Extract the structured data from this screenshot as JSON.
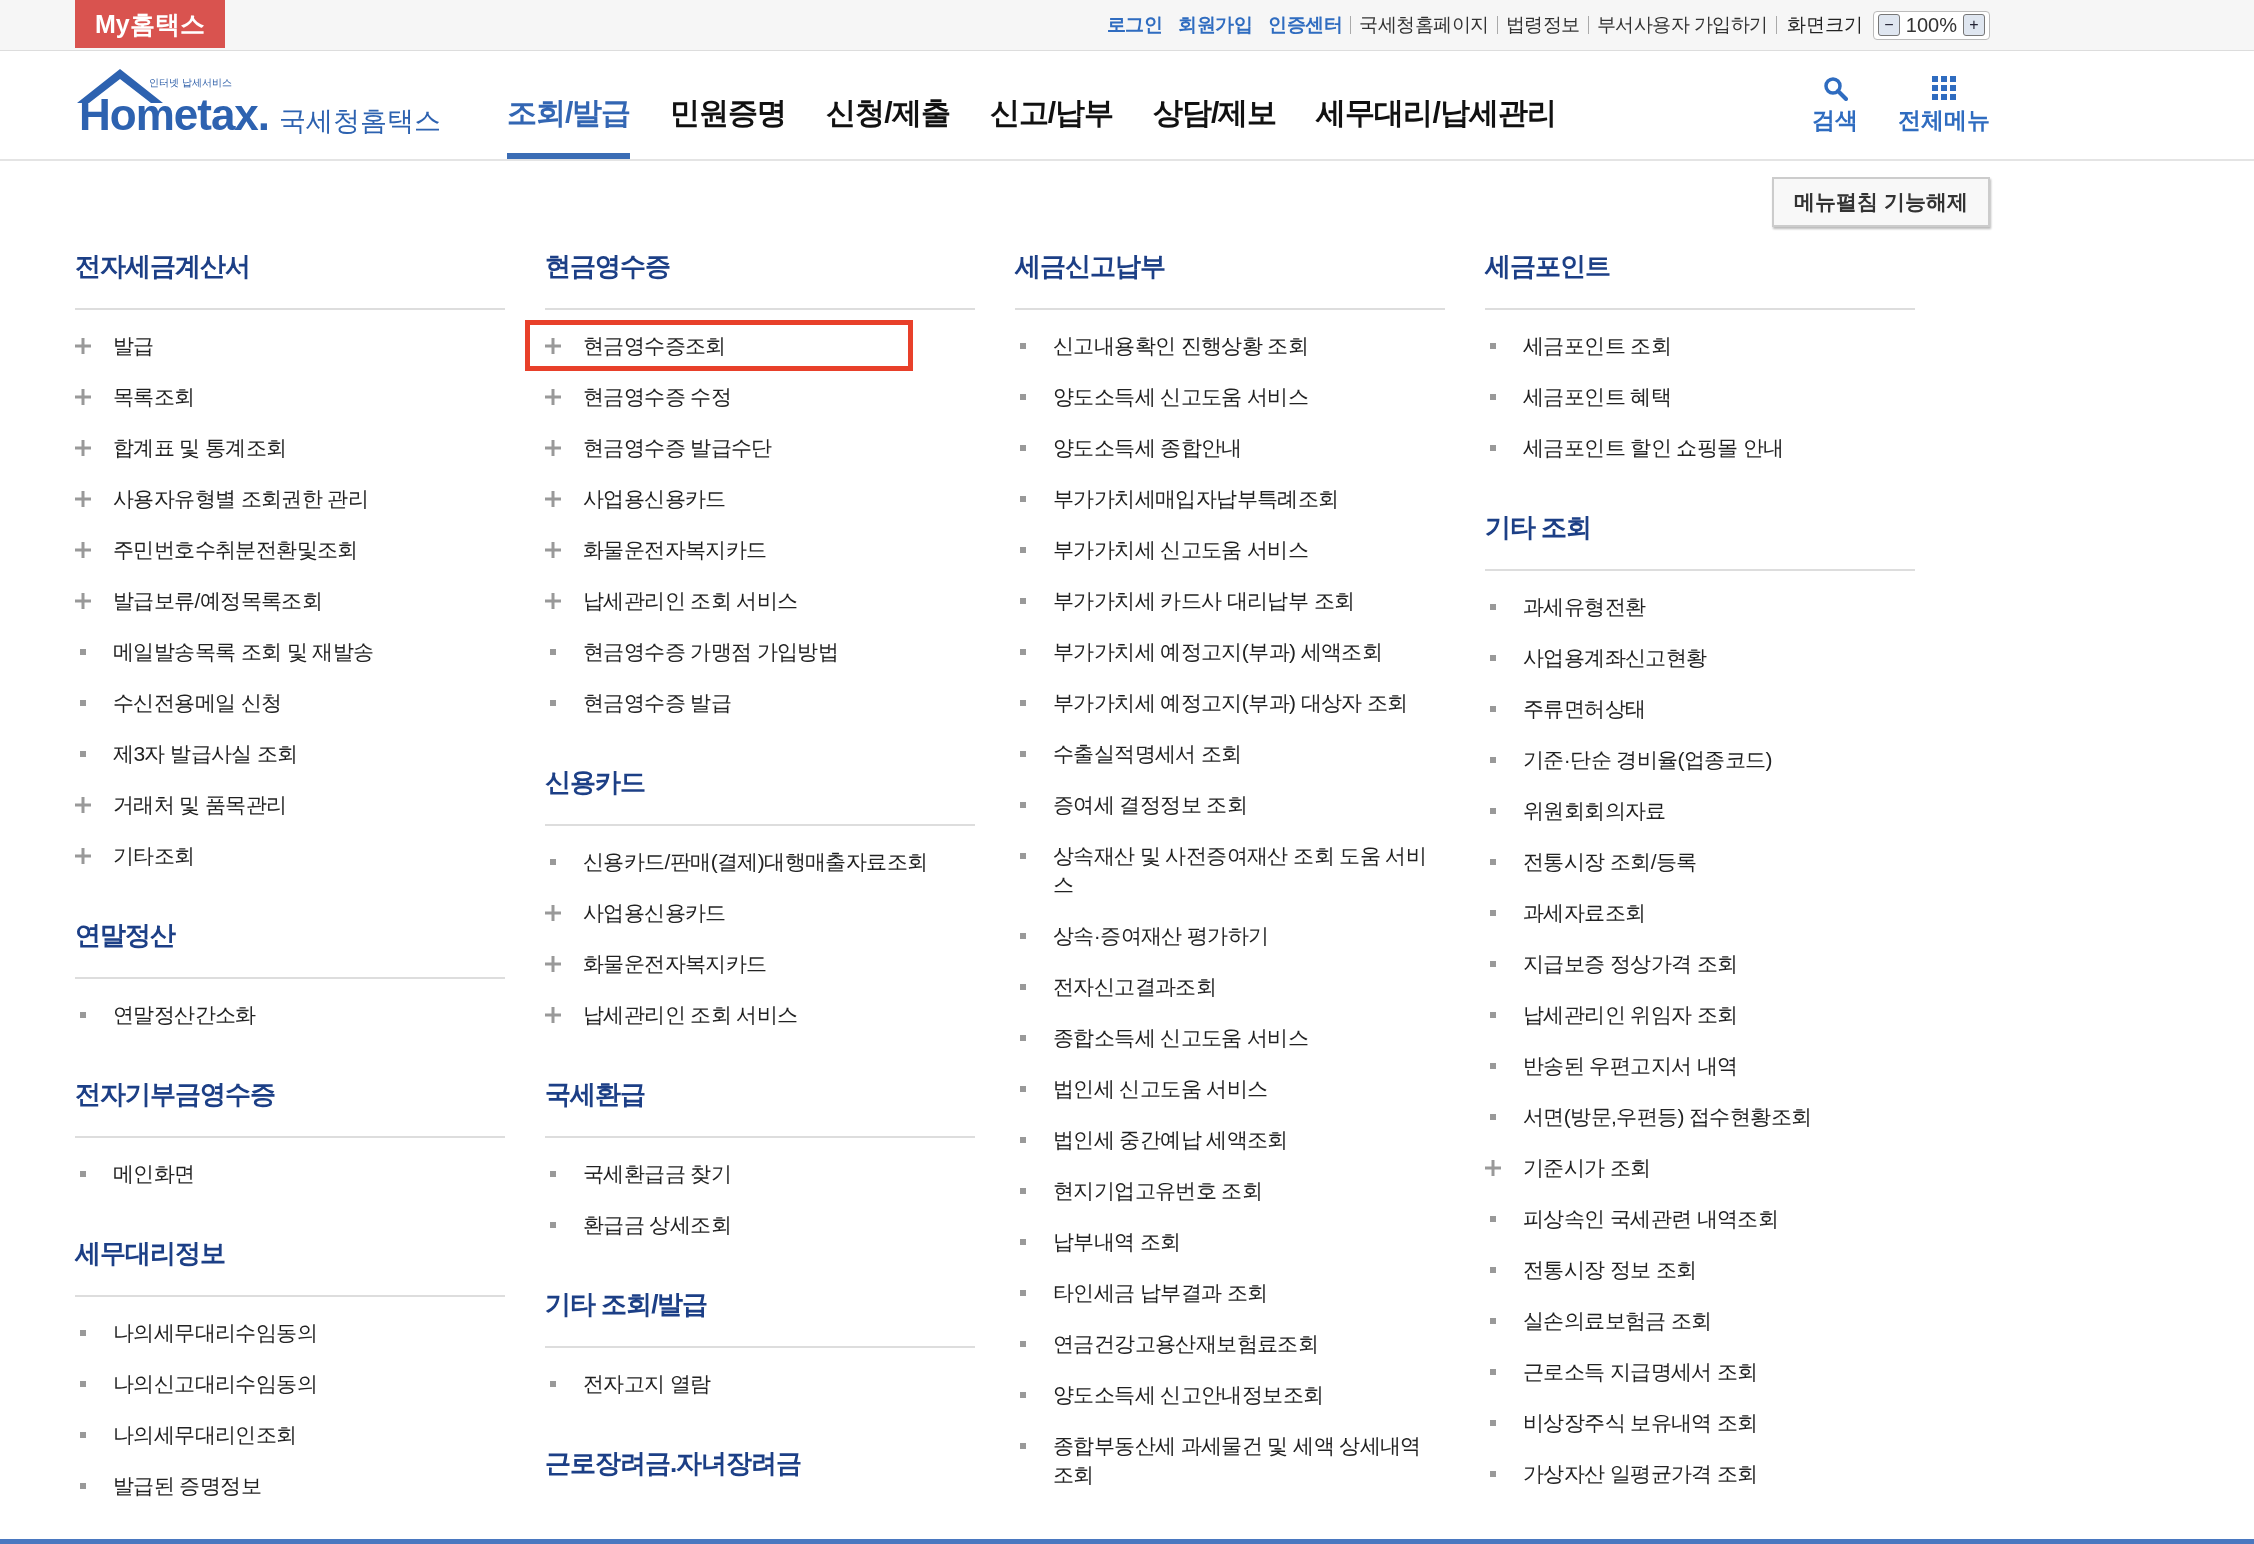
{
  "top_bar": {
    "my_tab": "My홈택스",
    "links": [
      {
        "label": "로그인",
        "emphasis": true
      },
      {
        "label": "회원가입",
        "emphasis": true
      },
      {
        "label": "인증센터",
        "emphasis": true
      },
      {
        "label": "국세청홈페이지",
        "emphasis": false
      },
      {
        "label": "법령정보",
        "emphasis": false
      },
      {
        "label": "부서사용자 가입하기",
        "emphasis": false
      }
    ],
    "zoom": {
      "label": "화면크기",
      "decrease": "−",
      "value": "100%",
      "increase": "+"
    }
  },
  "header": {
    "logo": {
      "tagline": "인터넷 납세서비스",
      "wordmark": "Hometax.",
      "korean": "국세청홈택스"
    },
    "tabs": [
      {
        "label": "조회/발급",
        "selected": true
      },
      {
        "label": "민원증명",
        "selected": false
      },
      {
        "label": "신청/제출",
        "selected": false
      },
      {
        "label": "신고/납부",
        "selected": false
      },
      {
        "label": "상담/제보",
        "selected": false
      },
      {
        "label": "세무대리/납세관리",
        "selected": false
      }
    ],
    "tools": [
      {
        "kind": "search",
        "label": "검색"
      },
      {
        "kind": "grid",
        "label": "전체메뉴"
      }
    ]
  },
  "collapse_button": "메뉴펼침 기능해제",
  "columns": [
    [
      {
        "title": "전자세금계산서",
        "items": [
          {
            "label": "발급",
            "kind": "plus",
            "selected": false
          },
          {
            "label": "목록조회",
            "kind": "plus",
            "selected": false
          },
          {
            "label": "합계표 및 통계조회",
            "kind": "plus",
            "selected": false
          },
          {
            "label": "사용자유형별 조회권한 관리",
            "kind": "plus",
            "selected": false
          },
          {
            "label": "주민번호수취분전환및조회",
            "kind": "plus",
            "selected": false
          },
          {
            "label": "발급보류/예정목록조회",
            "kind": "plus",
            "selected": false
          },
          {
            "label": "메일발송목록 조회 및 재발송",
            "kind": "bullet",
            "selected": false
          },
          {
            "label": "수신전용메일 신청",
            "kind": "bullet",
            "selected": false
          },
          {
            "label": "제3자 발급사실 조회",
            "kind": "bullet",
            "selected": false
          },
          {
            "label": "거래처 및 품목관리",
            "kind": "plus",
            "selected": false
          },
          {
            "label": "기타조회",
            "kind": "plus",
            "selected": false
          }
        ]
      },
      {
        "title": "연말정산",
        "items": [
          {
            "label": "연말정산간소화",
            "kind": "bullet",
            "selected": false
          }
        ]
      },
      {
        "title": "전자기부금영수증",
        "items": [
          {
            "label": "메인화면",
            "kind": "bullet",
            "selected": false
          }
        ]
      },
      {
        "title": "세무대리정보",
        "items": [
          {
            "label": "나의세무대리수임동의",
            "kind": "bullet",
            "selected": false
          },
          {
            "label": "나의신고대리수임동의",
            "kind": "bullet",
            "selected": false
          },
          {
            "label": "나의세무대리인조회",
            "kind": "bullet",
            "selected": false
          },
          {
            "label": "발급된 증명정보",
            "kind": "bullet",
            "selected": false
          }
        ]
      }
    ],
    [
      {
        "title": "현금영수증",
        "items": [
          {
            "label": "현금영수증조회",
            "kind": "plus",
            "selected": true
          },
          {
            "label": "현금영수증 수정",
            "kind": "plus",
            "selected": false
          },
          {
            "label": "현금영수증 발급수단",
            "kind": "plus",
            "selected": false
          },
          {
            "label": "사업용신용카드",
            "kind": "plus",
            "selected": false
          },
          {
            "label": "화물운전자복지카드",
            "kind": "plus",
            "selected": false
          },
          {
            "label": "납세관리인 조회 서비스",
            "kind": "plus",
            "selected": false
          },
          {
            "label": "현금영수증 가맹점 가입방법",
            "kind": "bullet",
            "selected": false
          },
          {
            "label": "현금영수증 발급",
            "kind": "bullet",
            "selected": false
          }
        ]
      },
      {
        "title": "신용카드",
        "items": [
          {
            "label": "신용카드/판매(결제)대행매출자료조회",
            "kind": "bullet",
            "selected": false
          },
          {
            "label": "사업용신용카드",
            "kind": "plus",
            "selected": false
          },
          {
            "label": "화물운전자복지카드",
            "kind": "plus",
            "selected": false
          },
          {
            "label": "납세관리인 조회 서비스",
            "kind": "plus",
            "selected": false
          }
        ]
      },
      {
        "title": "국세환급",
        "items": [
          {
            "label": "국세환급금 찾기",
            "kind": "bullet",
            "selected": false
          },
          {
            "label": "환급금 상세조회",
            "kind": "bullet",
            "selected": false
          }
        ]
      },
      {
        "title": "기타 조회/발급",
        "items": [
          {
            "label": "전자고지 열람",
            "kind": "bullet",
            "selected": false
          }
        ]
      },
      {
        "title": "근로장려금.자녀장려금"
      }
    ],
    [
      {
        "title": "세금신고납부",
        "items": [
          {
            "label": "신고내용확인 진행상황 조회",
            "kind": "bullet",
            "selected": false
          },
          {
            "label": "양도소득세 신고도움 서비스",
            "kind": "bullet",
            "selected": false
          },
          {
            "label": "양도소득세 종합안내",
            "kind": "bullet",
            "selected": false
          },
          {
            "label": "부가가치세매입자납부특례조회",
            "kind": "bullet",
            "selected": false
          },
          {
            "label": "부가가치세 신고도움 서비스",
            "kind": "bullet",
            "selected": false
          },
          {
            "label": "부가가치세 카드사 대리납부 조회",
            "kind": "bullet",
            "selected": false
          },
          {
            "label": "부가가치세 예정고지(부과) 세액조회",
            "kind": "bullet",
            "selected": false
          },
          {
            "label": "부가가치세 예정고지(부과) 대상자 조회",
            "kind": "bullet",
            "selected": false
          },
          {
            "label": "수출실적명세서 조회",
            "kind": "bullet",
            "selected": false
          },
          {
            "label": "증여세 결정정보 조회",
            "kind": "bullet",
            "selected": false
          },
          {
            "label": "상속재산 및 사전증여재산 조회 도움 서비스",
            "kind": "bullet",
            "selected": false
          },
          {
            "label": "상속·증여재산 평가하기",
            "kind": "bullet",
            "selected": false
          },
          {
            "label": "전자신고결과조회",
            "kind": "bullet",
            "selected": false
          },
          {
            "label": "종합소득세 신고도움 서비스",
            "kind": "bullet",
            "selected": false
          },
          {
            "label": "법인세 신고도움 서비스",
            "kind": "bullet",
            "selected": false
          },
          {
            "label": "법인세 중간예납 세액조회",
            "kind": "bullet",
            "selected": false
          },
          {
            "label": "현지기업고유번호 조회",
            "kind": "bullet",
            "selected": false
          },
          {
            "label": "납부내역 조회",
            "kind": "bullet",
            "selected": false
          },
          {
            "label": "타인세금 납부결과 조회",
            "kind": "bullet",
            "selected": false
          },
          {
            "label": "연금건강고용산재보험료조회",
            "kind": "bullet",
            "selected": false
          },
          {
            "label": "양도소득세 신고안내정보조회",
            "kind": "bullet",
            "selected": false
          },
          {
            "label": "종합부동산세 과세물건 및 세액 상세내역 조회",
            "kind": "bullet",
            "selected": false
          }
        ]
      }
    ],
    [
      {
        "title": "세금포인트",
        "items": [
          {
            "label": "세금포인트 조회",
            "kind": "bullet",
            "selected": false
          },
          {
            "label": "세금포인트 혜택",
            "kind": "bullet",
            "selected": false
          },
          {
            "label": "세금포인트 할인 쇼핑몰 안내",
            "kind": "bullet",
            "selected": false
          }
        ]
      },
      {
        "title": "기타 조회",
        "items": [
          {
            "label": "과세유형전환",
            "kind": "bullet",
            "selected": false
          },
          {
            "label": "사업용계좌신고현황",
            "kind": "bullet",
            "selected": false
          },
          {
            "label": "주류면허상태",
            "kind": "bullet",
            "selected": false
          },
          {
            "label": "기준·단순 경비율(업종코드)",
            "kind": "bullet",
            "selected": false
          },
          {
            "label": "위원회회의자료",
            "kind": "bullet",
            "selected": false
          },
          {
            "label": "전통시장 조회/등록",
            "kind": "bullet",
            "selected": false
          },
          {
            "label": "과세자료조회",
            "kind": "bullet",
            "selected": false
          },
          {
            "label": "지급보증 정상가격 조회",
            "kind": "bullet",
            "selected": false
          },
          {
            "label": "납세관리인 위임자 조회",
            "kind": "bullet",
            "selected": false
          },
          {
            "label": "반송된 우편고지서 내역",
            "kind": "bullet",
            "selected": false
          },
          {
            "label": "서면(방문,우편등) 접수현황조회",
            "kind": "bullet",
            "selected": false
          },
          {
            "label": "기준시가 조회",
            "kind": "plus",
            "selected": false
          },
          {
            "label": "피상속인 국세관련 내역조회",
            "kind": "bullet",
            "selected": false
          },
          {
            "label": "전통시장 정보 조회",
            "kind": "bullet",
            "selected": false
          },
          {
            "label": "실손의료보험금 조회",
            "kind": "bullet",
            "selected": false
          },
          {
            "label": "근로소득 지급명세서 조회",
            "kind": "bullet",
            "selected": false
          },
          {
            "label": "비상장주식 보유내역 조회",
            "kind": "bullet",
            "selected": false
          },
          {
            "label": "가상자산 일평균가격 조회",
            "kind": "bullet",
            "selected": false
          }
        ]
      }
    ]
  ]
}
